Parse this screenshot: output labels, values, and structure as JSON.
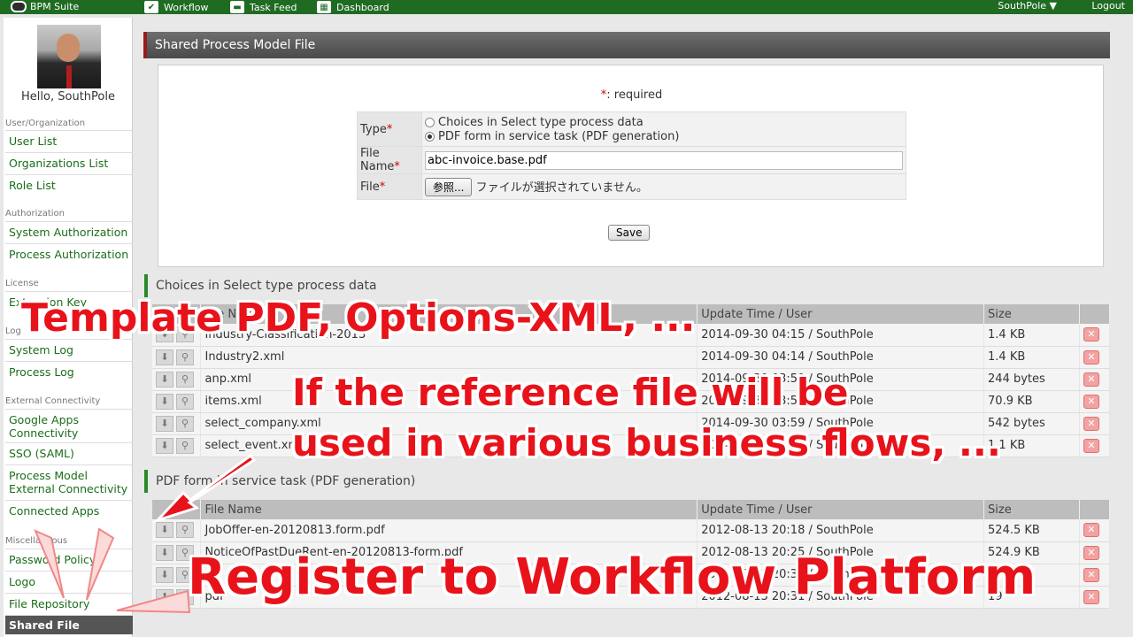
{
  "topbar": {
    "brand": "BPM Suite",
    "nav": [
      {
        "label": "Workflow",
        "icon": "check-icon"
      },
      {
        "label": "Task Feed",
        "icon": "chat-icon"
      },
      {
        "label": "Dashboard",
        "icon": "dashboard-icon"
      }
    ],
    "user": "SouthPole ▼",
    "logout": "Logout"
  },
  "sidebar": {
    "hello": "Hello, SouthPole",
    "sections": {
      "user_org": "User/Organization",
      "authorization": "Authorization",
      "license": "License",
      "log": "Log",
      "external": "External Connectivity",
      "misc": "Miscellaneous"
    },
    "items": {
      "user_list": "User List",
      "org_list": "Organizations List",
      "role_list": "Role List",
      "system_auth": "System Authorization",
      "process_auth": "Process Authorization",
      "extension_key": "Extension Key",
      "system_log": "System Log",
      "process_log": "Process Log",
      "google_apps": "Google Apps Connectivity",
      "sso": "SSO (SAML)",
      "pm_external": "Process Model External Connectivity",
      "connected_apps": "Connected Apps",
      "password_policy": "Password Policy",
      "logo": "Logo",
      "file_repo": "File Repository",
      "shared_file": "Shared File"
    }
  },
  "page": {
    "title": "Shared Process Model File",
    "required_star": "*",
    "required_text": ": required",
    "form": {
      "type_label": "Type",
      "type_option1": "Choices in Select type process data",
      "type_option2": "PDF form in service task (PDF generation)",
      "filename_label": "File Name",
      "filename_value": "abc-invoice.base.pdf",
      "file_label": "File",
      "browse_button": "参照...",
      "no_file_text": "ファイルが選択されていません。",
      "save_button": "Save"
    }
  },
  "choices_section": {
    "title": "Choices in Select type process data",
    "headers": [
      "File Name",
      "Update Time / User",
      "Size"
    ],
    "rows": [
      {
        "name": "Industry-Classification-2013",
        "time": "2014-09-30 04:15 / SouthPole",
        "size": "1.4 KB"
      },
      {
        "name": "Industry2.xml",
        "time": "2014-09-30 04:14 / SouthPole",
        "size": "1.4 KB"
      },
      {
        "name": "anp.xml",
        "time": "2014-09-30 03:59 / SouthPole",
        "size": "244 bytes"
      },
      {
        "name": "items.xml",
        "time": "2014-09-30 03:59 / SouthPole",
        "size": "70.9 KB"
      },
      {
        "name": "select_company.xml",
        "time": "2014-09-30 03:59 / SouthPole",
        "size": "542 bytes"
      },
      {
        "name": "select_event.xml",
        "time": "2014-09-30 03:54 / SouthPole",
        "size": "1.1 KB"
      }
    ]
  },
  "pdf_section": {
    "title": "PDF form in service task (PDF generation)",
    "headers": [
      "File Name",
      "Update Time / User",
      "Size"
    ],
    "rows": [
      {
        "name": "JobOffer-en-20120813.form.pdf",
        "time": "2012-08-13 20:18 / SouthPole",
        "size": "524.5 KB"
      },
      {
        "name": "NoticeOfPastDueRent-en-20120813-form.pdf",
        "time": "2012-08-13 20:25 / SouthPole",
        "size": "524.9 KB"
      },
      {
        "name": "",
        "time": "2012-08-13 20:30 / SouthPole",
        "size": "8"
      },
      {
        "name": "pdf",
        "time": "2012-08-13 20:31 / SouthPole",
        "size": "19"
      }
    ]
  },
  "captions": {
    "line1": "Template PDF, Options-XML, ...",
    "line2a": "If the reference file will be",
    "line2b": "used in various business flows, ...",
    "line3": "Register to Workflow Platform"
  },
  "colors": {
    "topbar": "#1f6b22",
    "caption_red": "#e8121a",
    "section_accent": "#2a8a2a",
    "title_accent": "#9a1b1b"
  }
}
